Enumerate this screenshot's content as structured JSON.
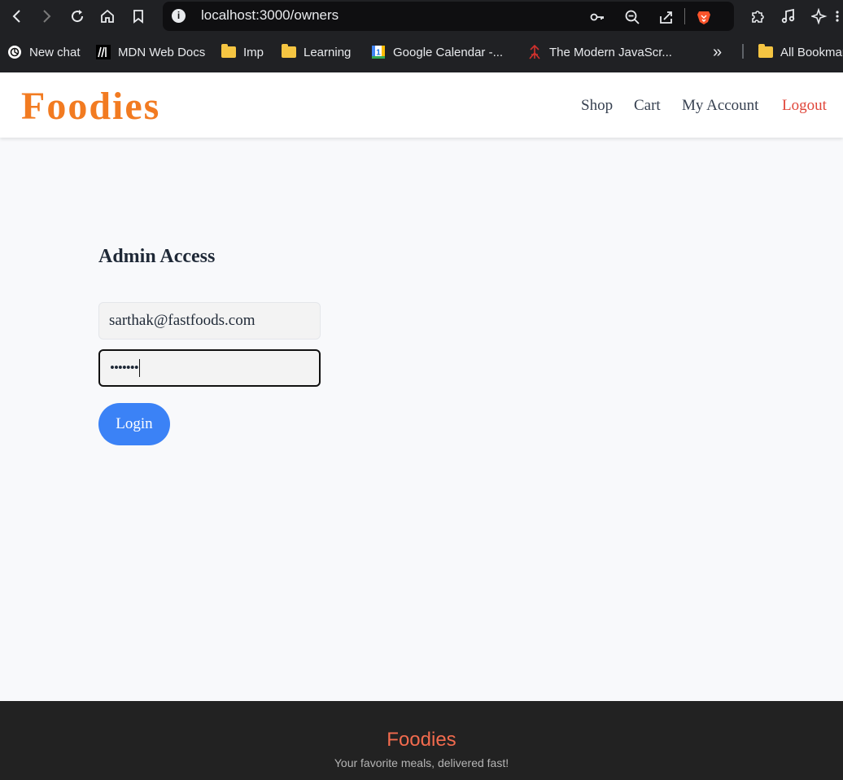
{
  "browser": {
    "url": "localhost:3000/owners",
    "bookmarks": [
      {
        "label": "New chat",
        "icon": "chatgpt-icon"
      },
      {
        "label": "MDN Web Docs",
        "icon": "mdn-icon"
      },
      {
        "label": "Imp",
        "icon": "folder-icon"
      },
      {
        "label": "Learning",
        "icon": "folder-icon"
      },
      {
        "label": "Google Calendar -...",
        "icon": "google-calendar-icon"
      },
      {
        "label": "The Modern JavaScr...",
        "icon": "javascript-info-icon"
      },
      {
        "label": "All Bookmar",
        "icon": "folder-icon"
      }
    ],
    "calendar_day": "1",
    "more_bookmarks": "»",
    "accent": "#f5c542"
  },
  "header": {
    "brand": "Foodies",
    "brand_color": "#f27b21",
    "nav": [
      {
        "label": "Shop"
      },
      {
        "label": "Cart"
      },
      {
        "label": "My Account"
      },
      {
        "label": "Logout",
        "color": "#e0463a"
      }
    ]
  },
  "form": {
    "title": "Admin Access",
    "email_value": "sarthak@fastfoods.com",
    "password_masked": "•••••••",
    "login_label": "Login",
    "login_color": "#3b82f6"
  },
  "footer": {
    "brand": "Foodies",
    "tagline": "Your favorite meals, delivered fast!"
  }
}
